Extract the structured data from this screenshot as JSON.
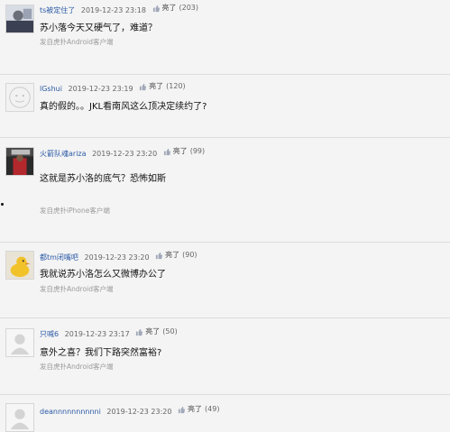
{
  "comments": [
    {
      "username": "ts被定住了",
      "time": "2019-12-23 23:18",
      "light_label": "亮了",
      "light_count": "(203)",
      "text": "苏小落今天又硬气了，难道？",
      "source": "发自虎扑Android客户端",
      "avatar": "photo-avatar-dark"
    },
    {
      "username": "lGshui",
      "time": "2019-12-23 23:19",
      "light_label": "亮了",
      "light_count": "(120)",
      "text": "真的假的。。JKL看南风这么顶决定续约了?",
      "source": "",
      "avatar": "default-user-avatar"
    },
    {
      "username": "火箭队魂ariza",
      "time": "2019-12-23 23:20",
      "light_label": "亮了",
      "light_count": "(99)",
      "text": "这就是苏小洛的底气？恐怖如斯",
      "source": "发自虎扑iPhone客户端",
      "avatar": "photo-avatar-basketball"
    },
    {
      "username": "都tm闭嘴吧",
      "time": "2019-12-23 23:20",
      "light_label": "亮了",
      "light_count": "(90)",
      "text": "我就说苏小洛怎么又微博办公了",
      "source": "发自虎扑Android客户端",
      "avatar": "duck-avatar"
    },
    {
      "username": "只喊6",
      "time": "2019-12-23 23:17",
      "light_label": "亮了",
      "light_count": "(50)",
      "text": "意外之喜？我们下路突然富裕?",
      "source": "发自虎扑Android客户端",
      "avatar": "default-user-avatar"
    },
    {
      "username": "deannnnnnnnnni",
      "time": "2019-12-23 23:20",
      "light_label": "亮了",
      "light_count": "(49)",
      "text": "",
      "source": "",
      "avatar": "default-user-avatar"
    }
  ],
  "colors": {
    "background": "#f4f4f4",
    "username": "#2b5aa6",
    "divider": "#dcdcdc"
  }
}
